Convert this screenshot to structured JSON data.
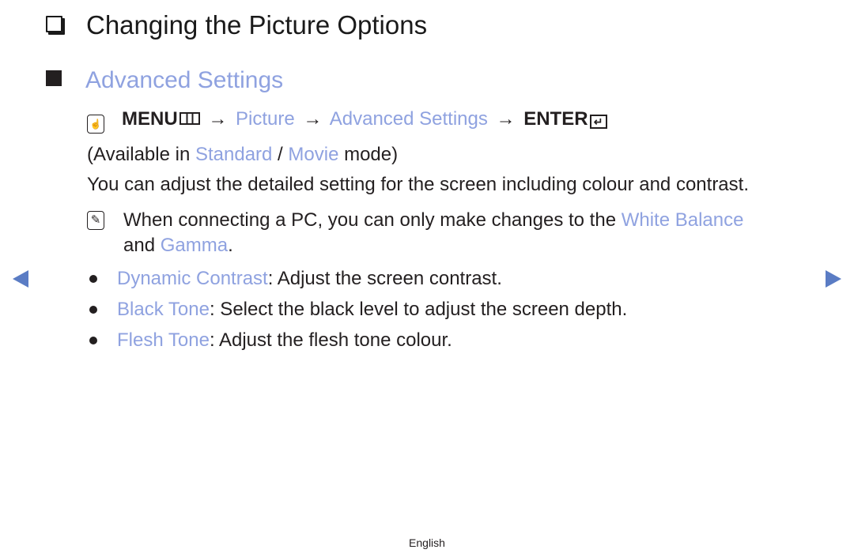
{
  "section_title": "Changing the Picture Options",
  "subsection_title": "Advanced Settings",
  "menu_path": {
    "icon": "remote-hand-icon",
    "menu_label": "MENU",
    "menu_icon": "menu-grid-icon",
    "arrow": "→",
    "step1": "Picture",
    "step2": "Advanced Settings",
    "enter_label": "ENTER",
    "enter_icon": "enter-icon",
    "enter_glyph": "↵"
  },
  "availability": {
    "prefix": "(Available in ",
    "mode1": "Standard",
    "separator": " / ",
    "mode2": "Movie",
    "suffix": " mode)"
  },
  "description": "You can adjust the detailed setting for the screen including colour and contrast.",
  "note": {
    "icon": "note-icon",
    "glyph": "✎",
    "text_before": "When connecting a PC, you can only make changes to the ",
    "link1": "White Balance",
    "line2_prefix": "and ",
    "link2": "Gamma",
    "line2_suffix": "."
  },
  "bullets": [
    {
      "term": "Dynamic Contrast",
      "text": ": Adjust the screen contrast."
    },
    {
      "term": "Black Tone",
      "text": ": Select the black level to adjust the screen depth."
    },
    {
      "term": "Flesh Tone",
      "text": ": Adjust the flesh tone colour."
    }
  ],
  "navigation": {
    "prev": "previous-page-arrow-icon",
    "next": "next-page-arrow-icon"
  },
  "footer": {
    "language": "English"
  },
  "colors": {
    "link": "#8fa2e0",
    "nav_arrow": "#5a7cc4",
    "text": "#231f20"
  }
}
